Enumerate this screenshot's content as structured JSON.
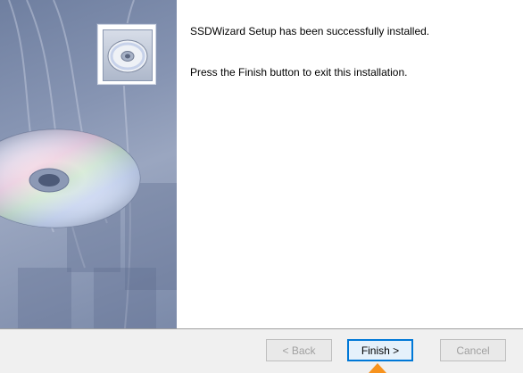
{
  "messages": {
    "installed": "SSDWizard Setup has been successfully installed.",
    "finish_hint": "Press the Finish button to exit this installation."
  },
  "buttons": {
    "back_label": "< Back",
    "finish_label": "Finish >",
    "cancel_label": "Cancel"
  },
  "icons": {
    "cd": "cd-disc-icon",
    "pointer": "pointer-arrow-icon"
  },
  "colors": {
    "side_panel": "#8795b3",
    "footer_bg": "#f0f0f0",
    "default_button_border": "#0078d7",
    "pointer": "#f7931e"
  }
}
